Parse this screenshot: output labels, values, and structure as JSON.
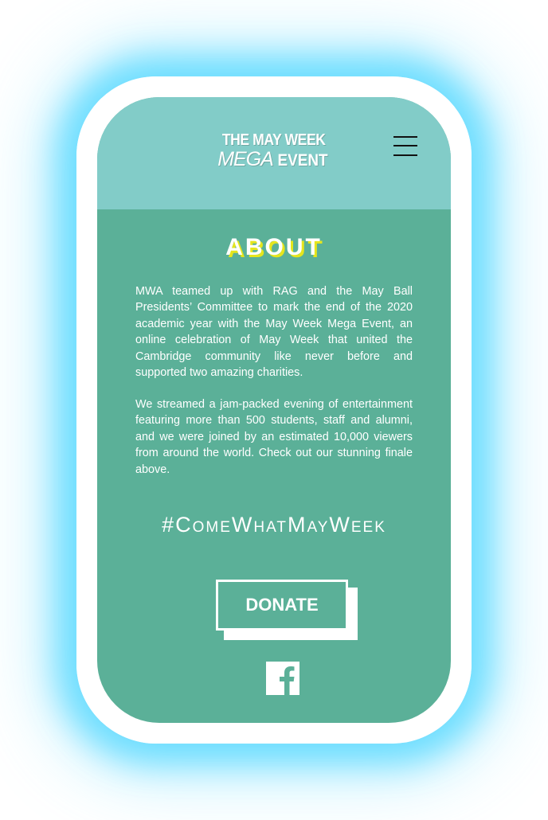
{
  "header": {
    "logo_line1": "THE MAY WEEK",
    "logo_mega": "MEGA",
    "logo_event": "EVENT",
    "menu_icon": "hamburger-menu-icon"
  },
  "main": {
    "title": "ABOUT",
    "paragraph1": "MWA teamed up with RAG and the May Ball Presidents’ Committee to mark the end of the 2020 academic year with the May Week Mega Event, an online celebration of May Week that united the Cambridge community like never before and supported two amazing charities.",
    "paragraph2": "We streamed a jam-packed evening of entertainment featuring more than 500 students, staff and alumni, and we were joined by an estimated 10,000 viewers from around the world. Check out our stunning finale above.",
    "hashtag": "#ComeWhatMayWeek",
    "donate_label": "DONATE",
    "social_icon": "facebook-icon"
  },
  "colors": {
    "header_bg": "#82ccc8",
    "body_bg": "#5bb098",
    "title_shadow": "#e6e61c",
    "glow": "#50d7ff"
  }
}
